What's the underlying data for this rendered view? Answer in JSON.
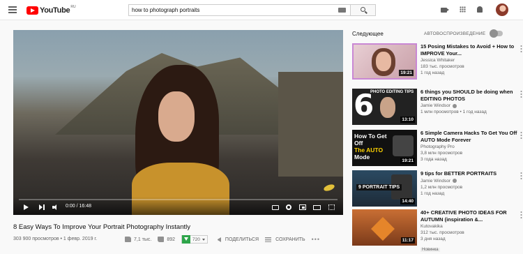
{
  "header": {
    "logo_text": "YouTube",
    "logo_region": "RU",
    "search_value": "how to photograph portraits"
  },
  "player": {
    "time": "0:00 / 16:48",
    "progress_fraction": 0
  },
  "video": {
    "title": "8 Easy Ways To Improve Your Portrait Photography Instantly",
    "views_date": "303 900 просмотров • 1 февр. 2019 г.",
    "likes": "7,1 тыс.",
    "dislikes": "892",
    "download_res": "720",
    "share_label": "ПОДЕЛИТЬСЯ",
    "save_label": "СОХРАНИТЬ",
    "more_label": "•••"
  },
  "sidebar": {
    "up_next_label": "Следующее",
    "autoplay_label": "АВТОВОСПРОИЗВЕДЕНИЕ",
    "recommendations": [
      {
        "title": "15 Posing Mistakes to Avoid + How to IMPROVE Your...",
        "channel": "Jessica Whitaker",
        "views": "183 тыс. просмотров",
        "age": "1 год назад",
        "duration": "19:21"
      },
      {
        "title": "6 things you SHOULD be doing when EDITING PHOTOS",
        "channel": "Jamie Windsor",
        "views": "1 млн просмотров",
        "age": "1 год назад",
        "duration": "13:10",
        "thumb_big": "6",
        "thumb_text": "PHOTO EDITING TIPS"
      },
      {
        "title": "6 Simple Camera Hacks To Get You Off AUTO Mode Forever",
        "channel": "Photography Pro",
        "views": "3,8 млн просмотров",
        "age": "3 года назад",
        "duration": "19:21",
        "thumb_text_a": "How To Get Off",
        "thumb_text_b": "The AUTO",
        "thumb_text_c": "Mode"
      },
      {
        "title": "9 tips for BETTER PORTRAITS",
        "channel": "Jamie Windsor",
        "views": "1,2 млн просмотров",
        "age": "1 год назад",
        "duration": "14:40",
        "thumb_text": "9 PORTRAIT TIPS"
      },
      {
        "title": "40+ CREATIVE PHOTO IDEAS FOR AUTUMN (inspiration &...",
        "channel": "Kutovakika",
        "views": "312 тыс. просмотров",
        "age": "3 дня назад",
        "duration": "11:17",
        "badge": "Новинка"
      }
    ]
  }
}
